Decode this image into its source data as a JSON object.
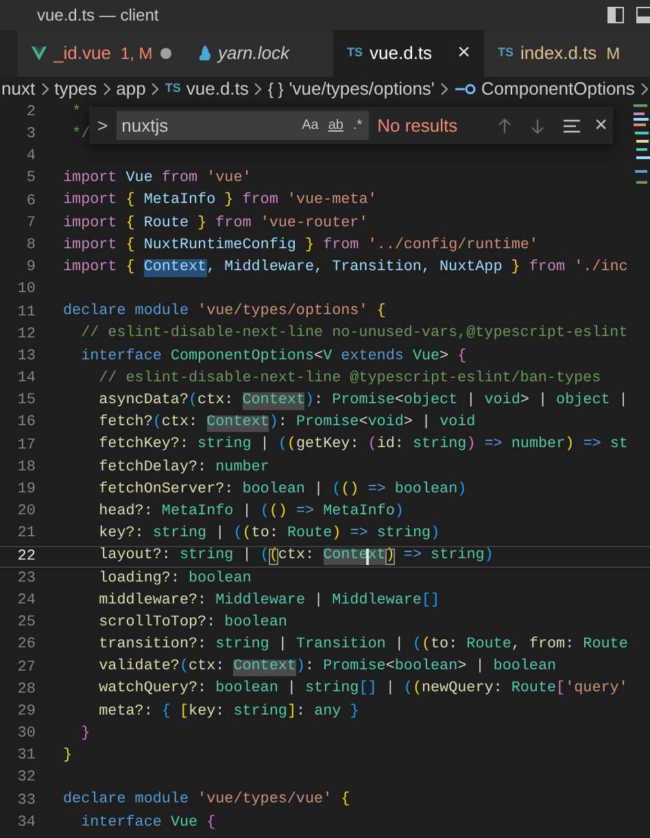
{
  "window": {
    "title": "vue.d.ts — client"
  },
  "tabs": [
    {
      "label": "_id.vue",
      "kind": "vue",
      "status": "1, M",
      "has_errors": true,
      "modified": true,
      "preview": false,
      "selected": false
    },
    {
      "label": "yarn.lock",
      "kind": "yarn",
      "has_errors": false,
      "git_modified": false,
      "modified": false,
      "preview": true,
      "selected": false
    },
    {
      "label": "vue.d.ts",
      "kind": "ts",
      "icon_text": "TS",
      "close": "×",
      "has_errors": false,
      "git_modified": false,
      "modified": false,
      "preview": false,
      "selected": true
    },
    {
      "label": "index.d.ts",
      "kind": "ts",
      "icon_text": "TS",
      "status": "M",
      "has_errors": false,
      "git_modified": true,
      "modified": false,
      "preview": false,
      "selected": false
    }
  ],
  "breadcrumbs": [
    {
      "label": "nuxt"
    },
    {
      "label": "types"
    },
    {
      "label": "app"
    },
    {
      "label": "vue.d.ts",
      "kind": "ts",
      "icon_text": "TS"
    },
    {
      "label": "'vue/types/options'",
      "kind": "module",
      "icon_text": "{ }"
    },
    {
      "label": "ComponentOptions",
      "kind": "interface"
    }
  ],
  "find_widget": {
    "toggle": ">",
    "value": "nuxtjs",
    "options": [
      {
        "label": "Aa",
        "underlined": false
      },
      {
        "label": "ab",
        "underlined": true
      },
      {
        "label": ".*",
        "underlined": false
      }
    ],
    "message": "No results",
    "close": "×"
  },
  "lines": [
    {
      "number": "2",
      "current": false,
      "tokens": [
        {
          "text": " *",
          "kind": "comment"
        }
      ]
    },
    {
      "number": "3",
      "current": false,
      "tokens": [
        {
          "text": " */",
          "kind": "comment"
        }
      ]
    },
    {
      "number": "4",
      "current": false
    },
    {
      "number": "5",
      "current": false,
      "tokens": [
        {
          "text": "import ",
          "kind": "control"
        },
        {
          "text": "Vue ",
          "kind": "variable"
        },
        {
          "text": "from ",
          "kind": "control"
        },
        {
          "text": "'vue'",
          "kind": "string"
        }
      ]
    },
    {
      "number": "6",
      "current": false,
      "tokens": [
        {
          "text": "import ",
          "kind": "control"
        },
        {
          "text": "{",
          "kind": "bracket1"
        },
        {
          "text": " MetaInfo ",
          "kind": "variable"
        },
        {
          "text": "}",
          "kind": "bracket1"
        },
        {
          "text": " from ",
          "kind": "control"
        },
        {
          "text": "'vue-meta'",
          "kind": "string"
        }
      ]
    },
    {
      "number": "7",
      "current": false,
      "tokens": [
        {
          "text": "import ",
          "kind": "control"
        },
        {
          "text": "{",
          "kind": "bracket1"
        },
        {
          "text": " Route ",
          "kind": "variable"
        },
        {
          "text": "}",
          "kind": "bracket1"
        },
        {
          "text": " from ",
          "kind": "control"
        },
        {
          "text": "'vue-router'",
          "kind": "string"
        }
      ]
    },
    {
      "number": "8",
      "current": false,
      "tokens": [
        {
          "text": "import ",
          "kind": "control"
        },
        {
          "text": "{",
          "kind": "bracket1"
        },
        {
          "text": " NuxtRuntimeConfig ",
          "kind": "variable"
        },
        {
          "text": "}",
          "kind": "bracket1"
        },
        {
          "text": " from ",
          "kind": "control"
        },
        {
          "text": "'../config/runtime'",
          "kind": "string"
        }
      ]
    },
    {
      "number": "9",
      "current": false,
      "tokens": [
        {
          "text": "import ",
          "kind": "control"
        },
        {
          "text": "{ ",
          "kind": "bracket1"
        },
        {
          "text": "Context",
          "kind": "variable",
          "selection": true
        },
        {
          "text": ", Middleware, Transition, NuxtApp ",
          "kind": "variable"
        },
        {
          "text": "}",
          "kind": "bracket1"
        },
        {
          "text": " from ",
          "kind": "control"
        },
        {
          "text": "'./inc",
          "kind": "string"
        }
      ]
    },
    {
      "number": "10",
      "current": false
    },
    {
      "number": "11",
      "current": false,
      "tokens": [
        {
          "text": "declare module ",
          "kind": "keyword"
        },
        {
          "text": "'vue/types/options' ",
          "kind": "string"
        },
        {
          "text": "{",
          "kind": "bracket1"
        }
      ]
    },
    {
      "number": "12",
      "current": false,
      "tokens": [
        {
          "text": "  // eslint-disable-next-line no-unused-vars,@typescript-eslint",
          "kind": "comment"
        }
      ]
    },
    {
      "number": "13",
      "current": false,
      "tokens": [
        {
          "text": "  interface ",
          "kind": "keyword"
        },
        {
          "text": "ComponentOptions",
          "kind": "type"
        },
        {
          "text": "<",
          "kind": "plain"
        },
        {
          "text": "V",
          "kind": "type"
        },
        {
          "text": " extends ",
          "kind": "keyword"
        },
        {
          "text": "Vue",
          "kind": "type"
        },
        {
          "text": "> ",
          "kind": "plain"
        },
        {
          "text": "{",
          "kind": "bracket2"
        }
      ]
    },
    {
      "number": "14",
      "current": false,
      "tokens": [
        {
          "text": "    // eslint-disable-next-line @typescript-eslint/ban-types",
          "kind": "comment"
        }
      ]
    },
    {
      "number": "15",
      "current": false,
      "tokens": [
        {
          "text": "    asyncData?",
          "kind": "property"
        },
        {
          "text": "(",
          "kind": "bracket3"
        },
        {
          "text": "ctx",
          "kind": "property"
        },
        {
          "text": ": ",
          "kind": "plain"
        },
        {
          "text": "Context",
          "kind": "type",
          "occurrence": true
        },
        {
          "text": ")",
          "kind": "bracket3"
        },
        {
          "text": ": ",
          "kind": "plain"
        },
        {
          "text": "Promise",
          "kind": "type"
        },
        {
          "text": "<",
          "kind": "plain"
        },
        {
          "text": "object",
          "kind": "type"
        },
        {
          "text": " | ",
          "kind": "plain"
        },
        {
          "text": "void",
          "kind": "type"
        },
        {
          "text": "> | ",
          "kind": "plain"
        },
        {
          "text": "object",
          "kind": "type"
        },
        {
          "text": " |",
          "kind": "plain"
        }
      ]
    },
    {
      "number": "16",
      "current": false,
      "tokens": [
        {
          "text": "    fetch?",
          "kind": "property"
        },
        {
          "text": "(",
          "kind": "bracket3"
        },
        {
          "text": "ctx",
          "kind": "property"
        },
        {
          "text": ": ",
          "kind": "plain"
        },
        {
          "text": "Context",
          "kind": "type",
          "occurrence": true
        },
        {
          "text": ")",
          "kind": "bracket3"
        },
        {
          "text": ": ",
          "kind": "plain"
        },
        {
          "text": "Promise",
          "kind": "type"
        },
        {
          "text": "<",
          "kind": "plain"
        },
        {
          "text": "void",
          "kind": "type"
        },
        {
          "text": "> | ",
          "kind": "plain"
        },
        {
          "text": "void",
          "kind": "type"
        }
      ]
    },
    {
      "number": "17",
      "current": false,
      "tokens": [
        {
          "text": "    fetchKey?",
          "kind": "property"
        },
        {
          "text": ": ",
          "kind": "plain"
        },
        {
          "text": "string",
          "kind": "type"
        },
        {
          "text": " | ",
          "kind": "plain"
        },
        {
          "text": "(",
          "kind": "bracket3"
        },
        {
          "text": "(",
          "kind": "bracket1"
        },
        {
          "text": "getKey",
          "kind": "property"
        },
        {
          "text": ": ",
          "kind": "plain"
        },
        {
          "text": "(",
          "kind": "bracket2"
        },
        {
          "text": "id",
          "kind": "property"
        },
        {
          "text": ": ",
          "kind": "plain"
        },
        {
          "text": "string",
          "kind": "type"
        },
        {
          "text": ")",
          "kind": "bracket2"
        },
        {
          "text": " => ",
          "kind": "keyword"
        },
        {
          "text": "number",
          "kind": "type"
        },
        {
          "text": ")",
          "kind": "bracket1"
        },
        {
          "text": " => ",
          "kind": "keyword"
        },
        {
          "text": "st",
          "kind": "type"
        }
      ]
    },
    {
      "number": "18",
      "current": false,
      "tokens": [
        {
          "text": "    fetchDelay?",
          "kind": "property"
        },
        {
          "text": ": ",
          "kind": "plain"
        },
        {
          "text": "number",
          "kind": "type"
        }
      ]
    },
    {
      "number": "19",
      "current": false,
      "tokens": [
        {
          "text": "    fetchOnServer?",
          "kind": "property"
        },
        {
          "text": ": ",
          "kind": "plain"
        },
        {
          "text": "boolean",
          "kind": "type"
        },
        {
          "text": " | ",
          "kind": "plain"
        },
        {
          "text": "(",
          "kind": "bracket3"
        },
        {
          "text": "()",
          "kind": "bracket1"
        },
        {
          "text": " => ",
          "kind": "keyword"
        },
        {
          "text": "boolean",
          "kind": "type"
        },
        {
          "text": ")",
          "kind": "bracket3"
        }
      ]
    },
    {
      "number": "20",
      "current": false,
      "tokens": [
        {
          "text": "    head?",
          "kind": "property"
        },
        {
          "text": ": ",
          "kind": "plain"
        },
        {
          "text": "MetaInfo",
          "kind": "type"
        },
        {
          "text": " | ",
          "kind": "plain"
        },
        {
          "text": "(",
          "kind": "bracket3"
        },
        {
          "text": "()",
          "kind": "bracket1"
        },
        {
          "text": " => ",
          "kind": "keyword"
        },
        {
          "text": "MetaInfo",
          "kind": "type"
        },
        {
          "text": ")",
          "kind": "bracket3"
        }
      ]
    },
    {
      "number": "21",
      "current": false,
      "tokens": [
        {
          "text": "    key?",
          "kind": "property"
        },
        {
          "text": ": ",
          "kind": "plain"
        },
        {
          "text": "string",
          "kind": "type"
        },
        {
          "text": " | ",
          "kind": "plain"
        },
        {
          "text": "(",
          "kind": "bracket3"
        },
        {
          "text": "(",
          "kind": "bracket1"
        },
        {
          "text": "to",
          "kind": "property"
        },
        {
          "text": ": ",
          "kind": "plain"
        },
        {
          "text": "Route",
          "kind": "type"
        },
        {
          "text": ")",
          "kind": "bracket1"
        },
        {
          "text": " => ",
          "kind": "keyword"
        },
        {
          "text": "string",
          "kind": "type"
        },
        {
          "text": ")",
          "kind": "bracket3"
        }
      ]
    },
    {
      "number": "22",
      "current": true,
      "tokens": [
        {
          "text": "    layout?",
          "kind": "property"
        },
        {
          "text": ": ",
          "kind": "plain"
        },
        {
          "text": "string",
          "kind": "type"
        },
        {
          "text": " | ",
          "kind": "plain"
        },
        {
          "text": "(",
          "kind": "bracket3"
        },
        {
          "text": "(",
          "kind": "bracket1",
          "matched": true
        },
        {
          "text": "ctx",
          "kind": "property"
        },
        {
          "text": ": ",
          "kind": "plain"
        },
        {
          "text": "Conte",
          "kind": "type",
          "occurrence": true,
          "caret_after": true
        },
        {
          "text": "xt",
          "kind": "type",
          "occurrence": true
        },
        {
          "text": ")",
          "kind": "bracket1",
          "matched": true
        },
        {
          "text": " => ",
          "kind": "keyword"
        },
        {
          "text": "string",
          "kind": "type"
        },
        {
          "text": ")",
          "kind": "bracket3"
        }
      ]
    },
    {
      "number": "23",
      "current": false,
      "tokens": [
        {
          "text": "    loading?",
          "kind": "property"
        },
        {
          "text": ": ",
          "kind": "plain"
        },
        {
          "text": "boolean",
          "kind": "type"
        }
      ]
    },
    {
      "number": "24",
      "current": false,
      "tokens": [
        {
          "text": "    middleware?",
          "kind": "property"
        },
        {
          "text": ": ",
          "kind": "plain"
        },
        {
          "text": "Middleware",
          "kind": "type"
        },
        {
          "text": " | ",
          "kind": "plain"
        },
        {
          "text": "Middleware",
          "kind": "type"
        },
        {
          "text": "[]",
          "kind": "bracket3"
        }
      ]
    },
    {
      "number": "25",
      "current": false,
      "tokens": [
        {
          "text": "    scrollToTop?",
          "kind": "property"
        },
        {
          "text": ": ",
          "kind": "plain"
        },
        {
          "text": "boolean",
          "kind": "type"
        }
      ]
    },
    {
      "number": "26",
      "current": false,
      "tokens": [
        {
          "text": "    transition?",
          "kind": "property"
        },
        {
          "text": ": ",
          "kind": "plain"
        },
        {
          "text": "string",
          "kind": "type"
        },
        {
          "text": " | ",
          "kind": "plain"
        },
        {
          "text": "Transition",
          "kind": "type"
        },
        {
          "text": " | ",
          "kind": "plain"
        },
        {
          "text": "(",
          "kind": "bracket3"
        },
        {
          "text": "(",
          "kind": "bracket1"
        },
        {
          "text": "to",
          "kind": "property"
        },
        {
          "text": ": ",
          "kind": "plain"
        },
        {
          "text": "Route",
          "kind": "type"
        },
        {
          "text": ", ",
          "kind": "plain"
        },
        {
          "text": "from",
          "kind": "property"
        },
        {
          "text": ": ",
          "kind": "plain"
        },
        {
          "text": "Route",
          "kind": "type"
        }
      ]
    },
    {
      "number": "27",
      "current": false,
      "tokens": [
        {
          "text": "    validate?",
          "kind": "property"
        },
        {
          "text": "(",
          "kind": "bracket3"
        },
        {
          "text": "ctx",
          "kind": "property"
        },
        {
          "text": ": ",
          "kind": "plain"
        },
        {
          "text": "Context",
          "kind": "type",
          "occurrence": true
        },
        {
          "text": ")",
          "kind": "bracket3"
        },
        {
          "text": ": ",
          "kind": "plain"
        },
        {
          "text": "Promise",
          "kind": "type"
        },
        {
          "text": "<",
          "kind": "plain"
        },
        {
          "text": "boolean",
          "kind": "type"
        },
        {
          "text": "> | ",
          "kind": "plain"
        },
        {
          "text": "boolean",
          "kind": "type"
        }
      ]
    },
    {
      "number": "28",
      "current": false,
      "tokens": [
        {
          "text": "    watchQuery?",
          "kind": "property"
        },
        {
          "text": ": ",
          "kind": "plain"
        },
        {
          "text": "boolean",
          "kind": "type"
        },
        {
          "text": " | ",
          "kind": "plain"
        },
        {
          "text": "string",
          "kind": "type"
        },
        {
          "text": "[]",
          "kind": "bracket3"
        },
        {
          "text": " | ",
          "kind": "plain"
        },
        {
          "text": "(",
          "kind": "bracket3"
        },
        {
          "text": "(",
          "kind": "bracket1"
        },
        {
          "text": "newQuery",
          "kind": "property"
        },
        {
          "text": ": ",
          "kind": "plain"
        },
        {
          "text": "Route",
          "kind": "type"
        },
        {
          "text": "[",
          "kind": "bracket2"
        },
        {
          "text": "'query'",
          "kind": "string"
        }
      ]
    },
    {
      "number": "29",
      "current": false,
      "tokens": [
        {
          "text": "    meta?",
          "kind": "property"
        },
        {
          "text": ": ",
          "kind": "plain"
        },
        {
          "text": "{ ",
          "kind": "bracket3"
        },
        {
          "text": "[",
          "kind": "bracket1"
        },
        {
          "text": "key",
          "kind": "property"
        },
        {
          "text": ": ",
          "kind": "plain"
        },
        {
          "text": "string",
          "kind": "type"
        },
        {
          "text": "]",
          "kind": "bracket1"
        },
        {
          "text": ": ",
          "kind": "plain"
        },
        {
          "text": "any ",
          "kind": "type"
        },
        {
          "text": "}",
          "kind": "bracket3"
        }
      ]
    },
    {
      "number": "30",
      "current": false,
      "tokens": [
        {
          "text": "  }",
          "kind": "bracket2"
        }
      ]
    },
    {
      "number": "31",
      "current": false,
      "tokens": [
        {
          "text": "}",
          "kind": "bracket1"
        }
      ]
    },
    {
      "number": "32",
      "current": false
    },
    {
      "number": "33",
      "current": false,
      "tokens": [
        {
          "text": "declare module ",
          "kind": "keyword"
        },
        {
          "text": "'vue/types/vue' ",
          "kind": "string"
        },
        {
          "text": "{",
          "kind": "bracket1"
        }
      ]
    },
    {
      "number": "34",
      "current": false,
      "tokens": [
        {
          "text": "  interface ",
          "kind": "keyword"
        },
        {
          "text": "Vue ",
          "kind": "type"
        },
        {
          "text": "{",
          "kind": "bracket2"
        }
      ]
    }
  ]
}
